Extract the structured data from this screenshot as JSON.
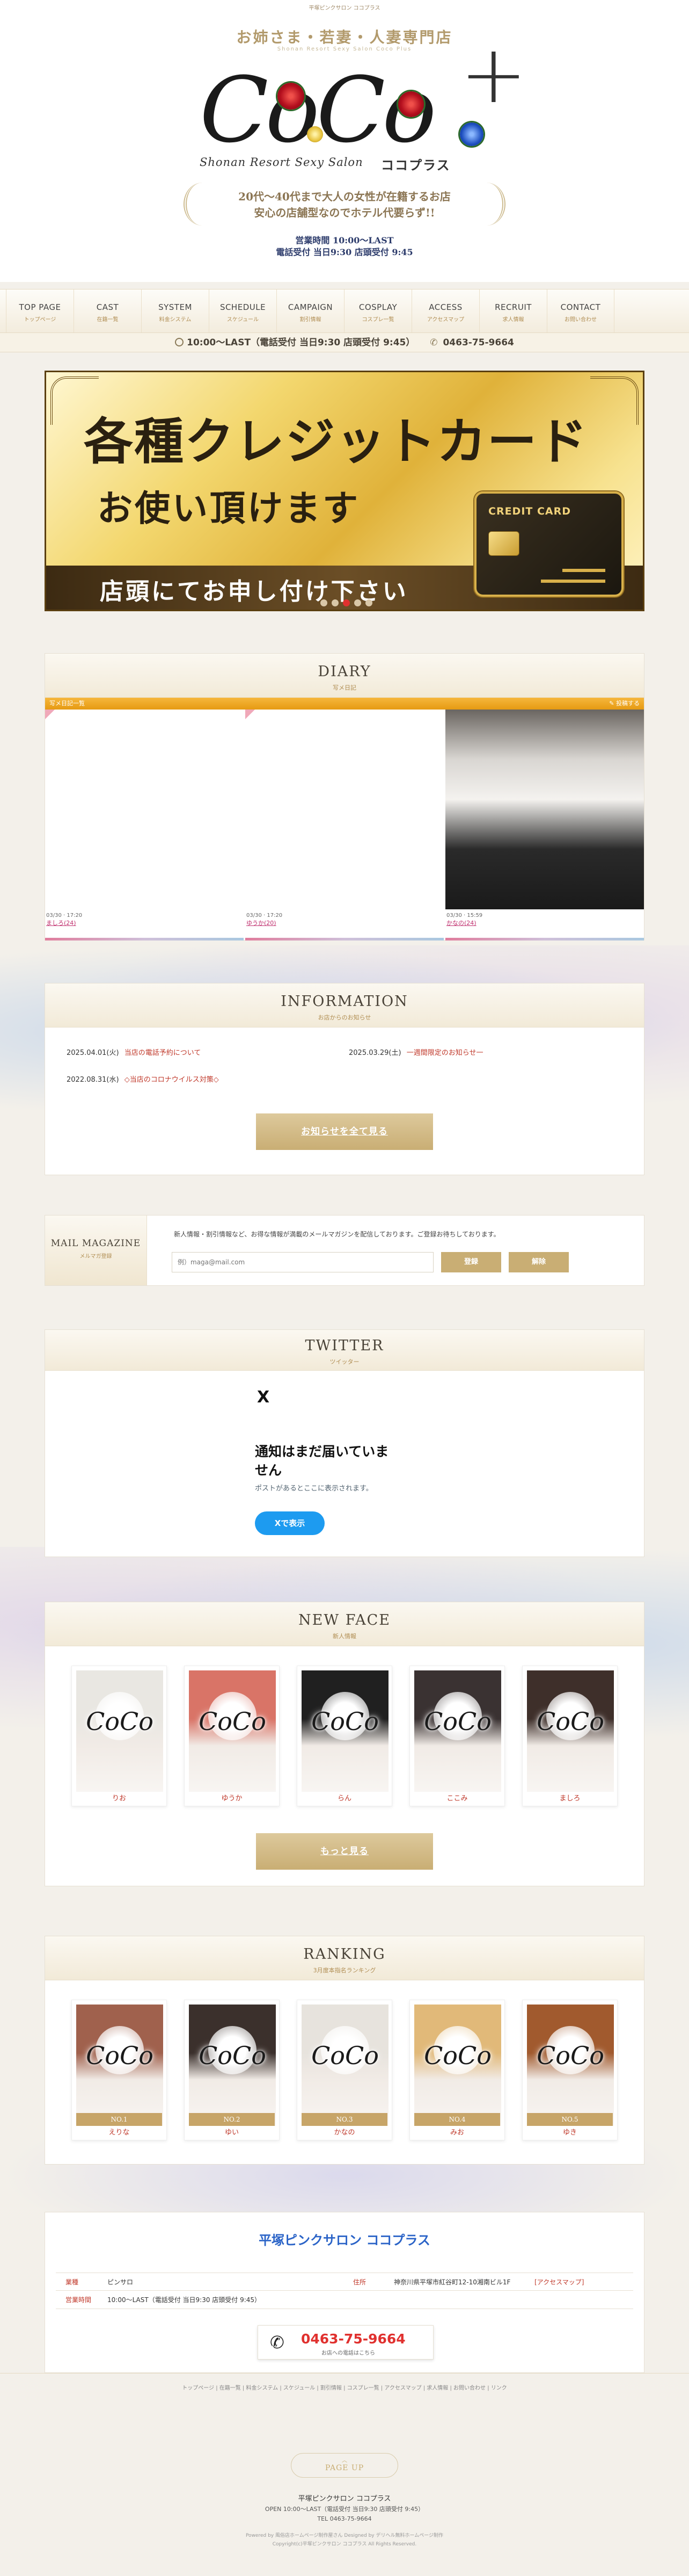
{
  "header": {
    "tiny_top": "平塚ピンクサロン ココプラス",
    "tagline": "お姉さま・若妻・人妻専門店",
    "subline": "Shonan Resort Sexy Salon Coco Plus",
    "logo_text": "CoCo",
    "logo_plus": "+",
    "logo_sub": "Shonan Resort Sexy Salon",
    "logo_kana": "ココプラス",
    "promo_line1": "20代～40代まで大人の女性が在籍するお店",
    "promo_line2": "安心の店舗型なのでホテル代要らず!!",
    "hours_line1": "営業時間 10:00～LAST",
    "hours_line2": "電話受付 当日9:30 店頭受付 9:45"
  },
  "nav": [
    {
      "en": "TOP PAGE",
      "jp": "トップページ"
    },
    {
      "en": "CAST",
      "jp": "在籍一覧"
    },
    {
      "en": "SYSTEM",
      "jp": "料金システム"
    },
    {
      "en": "SCHEDULE",
      "jp": "スケジュール"
    },
    {
      "en": "CAMPAIGN",
      "jp": "割引情報"
    },
    {
      "en": "COSPLAY",
      "jp": "コスプレ一覧"
    },
    {
      "en": "ACCESS",
      "jp": "アクセスマップ"
    },
    {
      "en": "RECRUIT",
      "jp": "求人情報"
    },
    {
      "en": "CONTACT",
      "jp": "お問い合わせ"
    }
  ],
  "infobar": {
    "hours": "10:00～LAST（電話受付 当日9:30 店頭受付 9:45）",
    "phone": "0463-75-9664"
  },
  "banner": {
    "line1": "各種クレジットカード",
    "line2": "お使い頂けます",
    "line3": "店頭にてお申し付け下さい",
    "card_label": "CREDIT CARD",
    "dots": 5,
    "active_dot": 3
  },
  "diary": {
    "title": "DIARY",
    "subtitle": "写メ日記",
    "bar_left": "写メ日記一覧",
    "bar_right": "投稿する",
    "posts": [
      {
        "meta": "03/30 · 17:20",
        "name": "ましろ(24)"
      },
      {
        "meta": "03/30 · 17:20",
        "name": "ゆうか(20)"
      },
      {
        "meta": "03/30 · 15:59",
        "name": "かなの(24)"
      }
    ]
  },
  "information": {
    "title": "INFORMATION",
    "subtitle": "お店からのお知らせ",
    "items": [
      {
        "date": "2025.04.01(火)",
        "text": "当店の電話予約について"
      },
      {
        "date": "2025.03.29(土)",
        "text": "一週間限定のお知らせ一"
      },
      {
        "date": "2022.08.31(水)",
        "text": "◇当店のコロナウイルス対策◇"
      }
    ],
    "button": "お知らせを全て見る"
  },
  "mail": {
    "title": "MAIL MAGAZINE",
    "subtitle": "メルマガ登録",
    "desc": "新人情報・割引情報など、お得な情報が満載のメールマガジンを配信しております。ご登録お待ちしております。",
    "placeholder": "例）maga@mail.com",
    "register": "登録",
    "cancel": "解除"
  },
  "twitter": {
    "title": "TWITTER",
    "subtitle": "ツイッター",
    "x_icon": "X",
    "empty_title_1": "通知はまだ届いていま",
    "empty_title_2": "せん",
    "empty_desc": "ポストがあるとここに表示されます。",
    "button": "Xで表示"
  },
  "newface": {
    "title": "NEW FACE",
    "subtitle": "新人情報",
    "casts": [
      {
        "name": "りお",
        "hair": "#e9e7e2"
      },
      {
        "name": "ゆうか",
        "hair": "#d97467"
      },
      {
        "name": "らん",
        "hair": "#202020"
      },
      {
        "name": "ここみ",
        "hair": "#3a3232"
      },
      {
        "name": "ましろ",
        "hair": "#3e2f2a"
      }
    ],
    "button": "もっと見る"
  },
  "ranking": {
    "title": "RANKING",
    "subtitle": "3月度本指名ランキング",
    "casts": [
      {
        "rank": "NO.1",
        "name": "えりな",
        "hair": "#a0614d"
      },
      {
        "rank": "NO.2",
        "name": "ゆい",
        "hair": "#3b302c"
      },
      {
        "rank": "NO.3",
        "name": "かなの",
        "hair": "#e7e3dd"
      },
      {
        "rank": "NO.4",
        "name": "みお",
        "hair": "#e1b979"
      },
      {
        "rank": "NO.5",
        "name": "ゆき",
        "hair": "#a15a2e"
      }
    ]
  },
  "shop": {
    "title": "平塚ピンクサロン ココプラス",
    "genre_label": "業種",
    "genre": "ピンサロ",
    "address_label": "住所",
    "address": "神奈川県平塚市紅谷町12-10湘南ビル1F",
    "address_link": "[アクセスマップ]",
    "hours_label": "営業時間",
    "hours": "10:00～LAST（電話受付 当日9:30 店頭受付 9:45）",
    "phone": "0463-75-9664",
    "phone_note": "お店への電話はこちら"
  },
  "footer": {
    "links": "トップページ | 在籍一覧 | 料金システム | スケジュール | 割引情報 | コスプレ一覧 | アクセスマップ | 求人情報 | お問い合わせ | リンク",
    "pagetop": "PAGE UP",
    "shop_name": "平塚ピンクサロン ココプラス",
    "open": "OPEN 10:00～LAST（電話受付 当日9:30 店頭受付 9:45）",
    "tel": "TEL 0463-75-9664",
    "powered": "Powered by 風俗店ホームページ制作屋さん Designed by デリヘル無料ホームページ制作",
    "copyright": "Copyright(c)平塚ピンクサロン ココプラス All Rights Reserved."
  },
  "colors": {
    "accent_gold": "#c9ae74",
    "link_red": "#c0392b",
    "twitter_blue": "#1d9bf0"
  }
}
